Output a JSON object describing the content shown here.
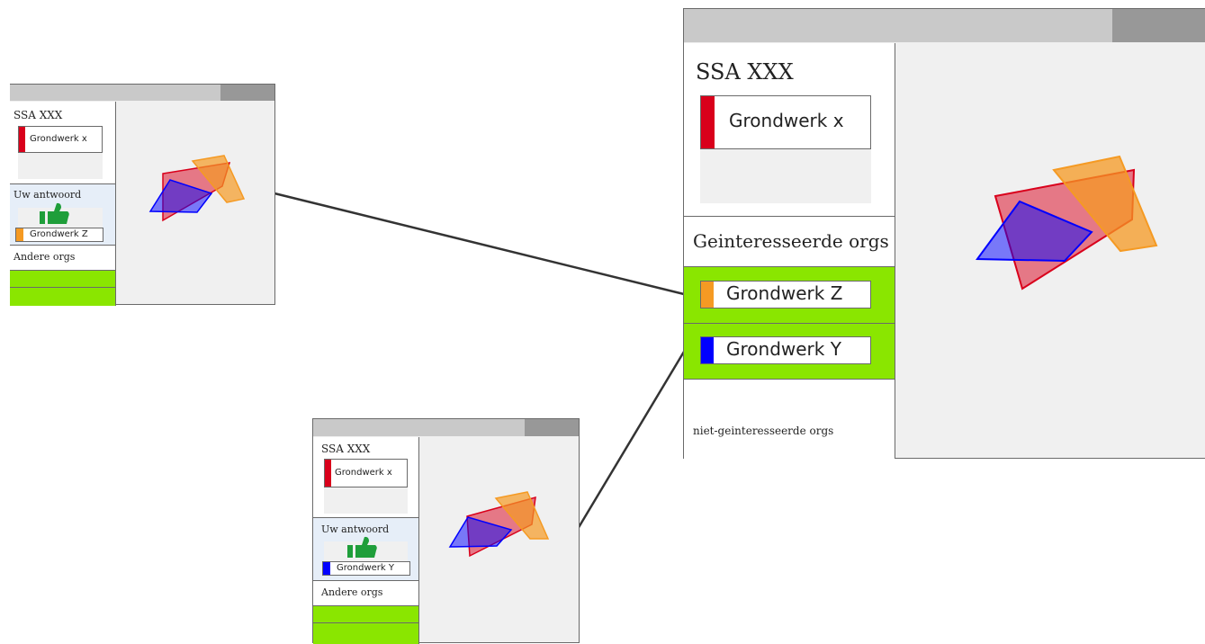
{
  "colors": {
    "accent_green": "#8ae600",
    "org_x": "#d9001b",
    "org_z": "#f59a23",
    "org_y": "#0000ff",
    "thumb": "#1f9e3a",
    "answer_bg": "#e6eef8",
    "titlebar": "#c9c9c9",
    "titlebar_button": "#989898"
  },
  "windows": {
    "main": {
      "app_title": "SSA XXX",
      "own_org": "Grondwerk x",
      "interested_header": "Geinteresseerde orgs",
      "interested_orgs": [
        "Grondwerk Z",
        "Grondwerk Y"
      ],
      "not_interested_label": "niet-geinteresseerde orgs"
    },
    "small_z": {
      "app_title": "SSA XXX",
      "own_org": "Grondwerk x",
      "answer_label": "Uw antwoord",
      "answer_icon": "thumbs-up-icon",
      "answer_org": "Grondwerk Z",
      "others_label": "Andere orgs"
    },
    "small_y": {
      "app_title": "SSA XXX",
      "own_org": "Grondwerk x",
      "answer_label": "Uw antwoord",
      "answer_icon": "thumbs-up-icon",
      "answer_org": "Grondwerk Y",
      "others_label": "Andere orgs"
    }
  }
}
